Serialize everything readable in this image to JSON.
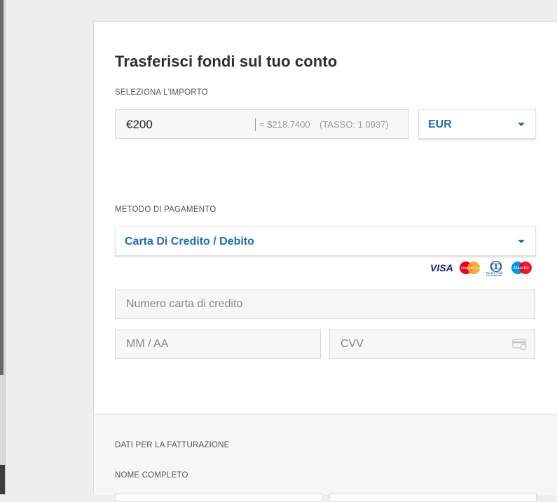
{
  "page": {
    "title": "Trasferisci fondi sul tuo conto"
  },
  "amount": {
    "label": "SELEZIONA L'IMPORTO",
    "value": "€200",
    "conversion": "= $218.7400",
    "rate": "(TASSO: 1.0937)"
  },
  "currency": {
    "selected": "EUR",
    "icon": "chevron-down-icon"
  },
  "payment": {
    "label": "METODO DI PAGAMENTO",
    "selected": "Carta Di Credito / Debito",
    "card_brands": [
      "VISA",
      "MasterCard",
      "Diners Club International",
      "Maestro"
    ]
  },
  "card_form": {
    "number_placeholder": "Numero carta di credito",
    "expiry_placeholder": "MM / AA",
    "cvv_placeholder": "CVV"
  },
  "billing": {
    "section_label": "DATI PER LA FATTURAZIONE",
    "name_label": "NOME COMPLETO"
  },
  "colors": {
    "accent": "#1f6fa8",
    "visa": "#1a1f71",
    "mastercard_red": "#eb001b",
    "mastercard_yellow": "#f79e1b",
    "maestro_blue": "#0099df"
  }
}
